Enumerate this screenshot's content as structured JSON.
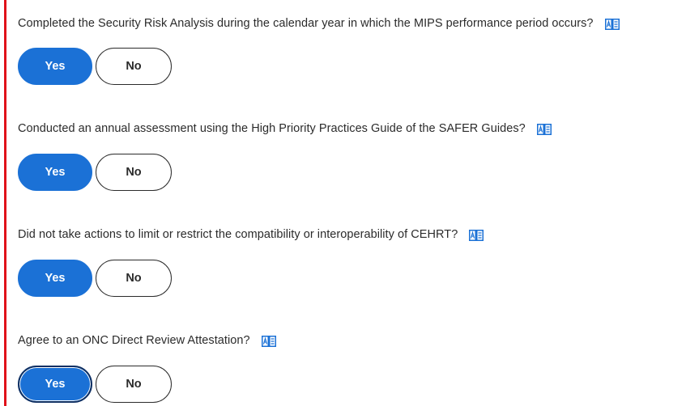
{
  "questions": [
    {
      "text": "Completed the Security Risk Analysis during the calendar year in which the MIPS performance period occurs?",
      "icon": "glossary-book-icon",
      "yes_label": "Yes",
      "no_label": "No",
      "selected": "Yes"
    },
    {
      "text": "Conducted an annual assessment using the High Priority Practices Guide of the SAFER Guides?",
      "icon": "glossary-book-icon",
      "yes_label": "Yes",
      "no_label": "No",
      "selected": "Yes"
    },
    {
      "text": "Did not take actions to limit or restrict the compatibility or interoperability of CEHRT?",
      "icon": "glossary-book-icon",
      "yes_label": "Yes",
      "no_label": "No",
      "selected": "Yes"
    },
    {
      "text": "Agree to an ONC Direct Review Attestation?",
      "icon": "glossary-book-icon",
      "yes_label": "Yes",
      "no_label": "No",
      "selected": "Yes"
    }
  ],
  "colors": {
    "accent": "#1b71d6",
    "highlight_border": "#e0121a",
    "focus_ring": "#0d2f63"
  }
}
